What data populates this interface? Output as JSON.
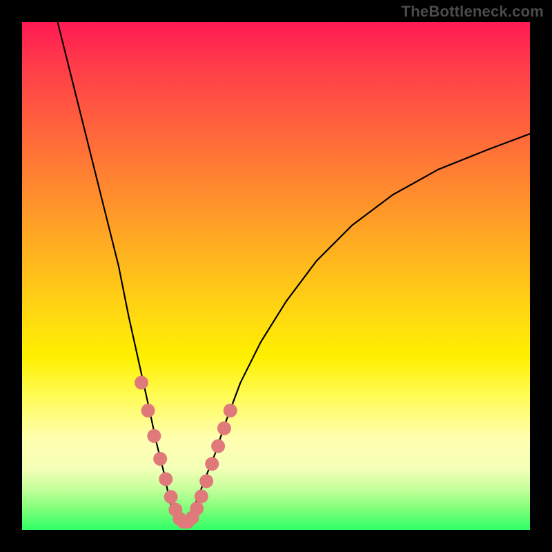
{
  "watermark": "TheBottleneck.com",
  "chart_data": {
    "type": "line",
    "title": "",
    "xlabel": "",
    "ylabel": "",
    "xlim": [
      0,
      100
    ],
    "ylim": [
      0,
      100
    ],
    "curve": {
      "x": [
        7,
        10,
        13,
        16,
        19,
        21,
        23,
        25,
        26.5,
        28,
        29,
        30,
        31,
        32,
        33,
        34.5,
        36,
        38,
        40,
        43,
        47,
        52,
        58,
        65,
        73,
        82,
        92,
        100
      ],
      "y": [
        100,
        88,
        76,
        64,
        52,
        42,
        33,
        24,
        17,
        11,
        6,
        3,
        1.5,
        1.5,
        3,
        6,
        10,
        15,
        21,
        29,
        37,
        45,
        53,
        60,
        66,
        71,
        75,
        78
      ]
    },
    "markers": {
      "x": [
        23.5,
        24.8,
        26.0,
        27.2,
        28.3,
        29.3,
        30.2,
        31.0,
        31.8,
        32.6,
        33.5,
        34.4,
        35.3,
        36.3,
        37.4,
        38.6,
        39.8,
        41.0
      ],
      "y": [
        29.0,
        23.5,
        18.5,
        14.0,
        10.0,
        6.5,
        4.0,
        2.2,
        1.6,
        1.6,
        2.4,
        4.2,
        6.6,
        9.6,
        13.0,
        16.5,
        20.0,
        23.5
      ],
      "color": "#e07a7a",
      "radius_px": 10
    },
    "gradient_stops": [
      {
        "pos": 0.0,
        "color": "#ff1a53"
      },
      {
        "pos": 0.08,
        "color": "#ff3a4a"
      },
      {
        "pos": 0.18,
        "color": "#ff5a3f"
      },
      {
        "pos": 0.28,
        "color": "#ff7a34"
      },
      {
        "pos": 0.38,
        "color": "#ff9a28"
      },
      {
        "pos": 0.48,
        "color": "#ffba1c"
      },
      {
        "pos": 0.58,
        "color": "#ffda10"
      },
      {
        "pos": 0.66,
        "color": "#fff000"
      },
      {
        "pos": 0.74,
        "color": "#fffc5a"
      },
      {
        "pos": 0.82,
        "color": "#ffffb0"
      },
      {
        "pos": 0.88,
        "color": "#f4ffb8"
      },
      {
        "pos": 0.92,
        "color": "#c4ff9a"
      },
      {
        "pos": 0.96,
        "color": "#7dff79"
      },
      {
        "pos": 1.0,
        "color": "#2fff66"
      }
    ]
  }
}
